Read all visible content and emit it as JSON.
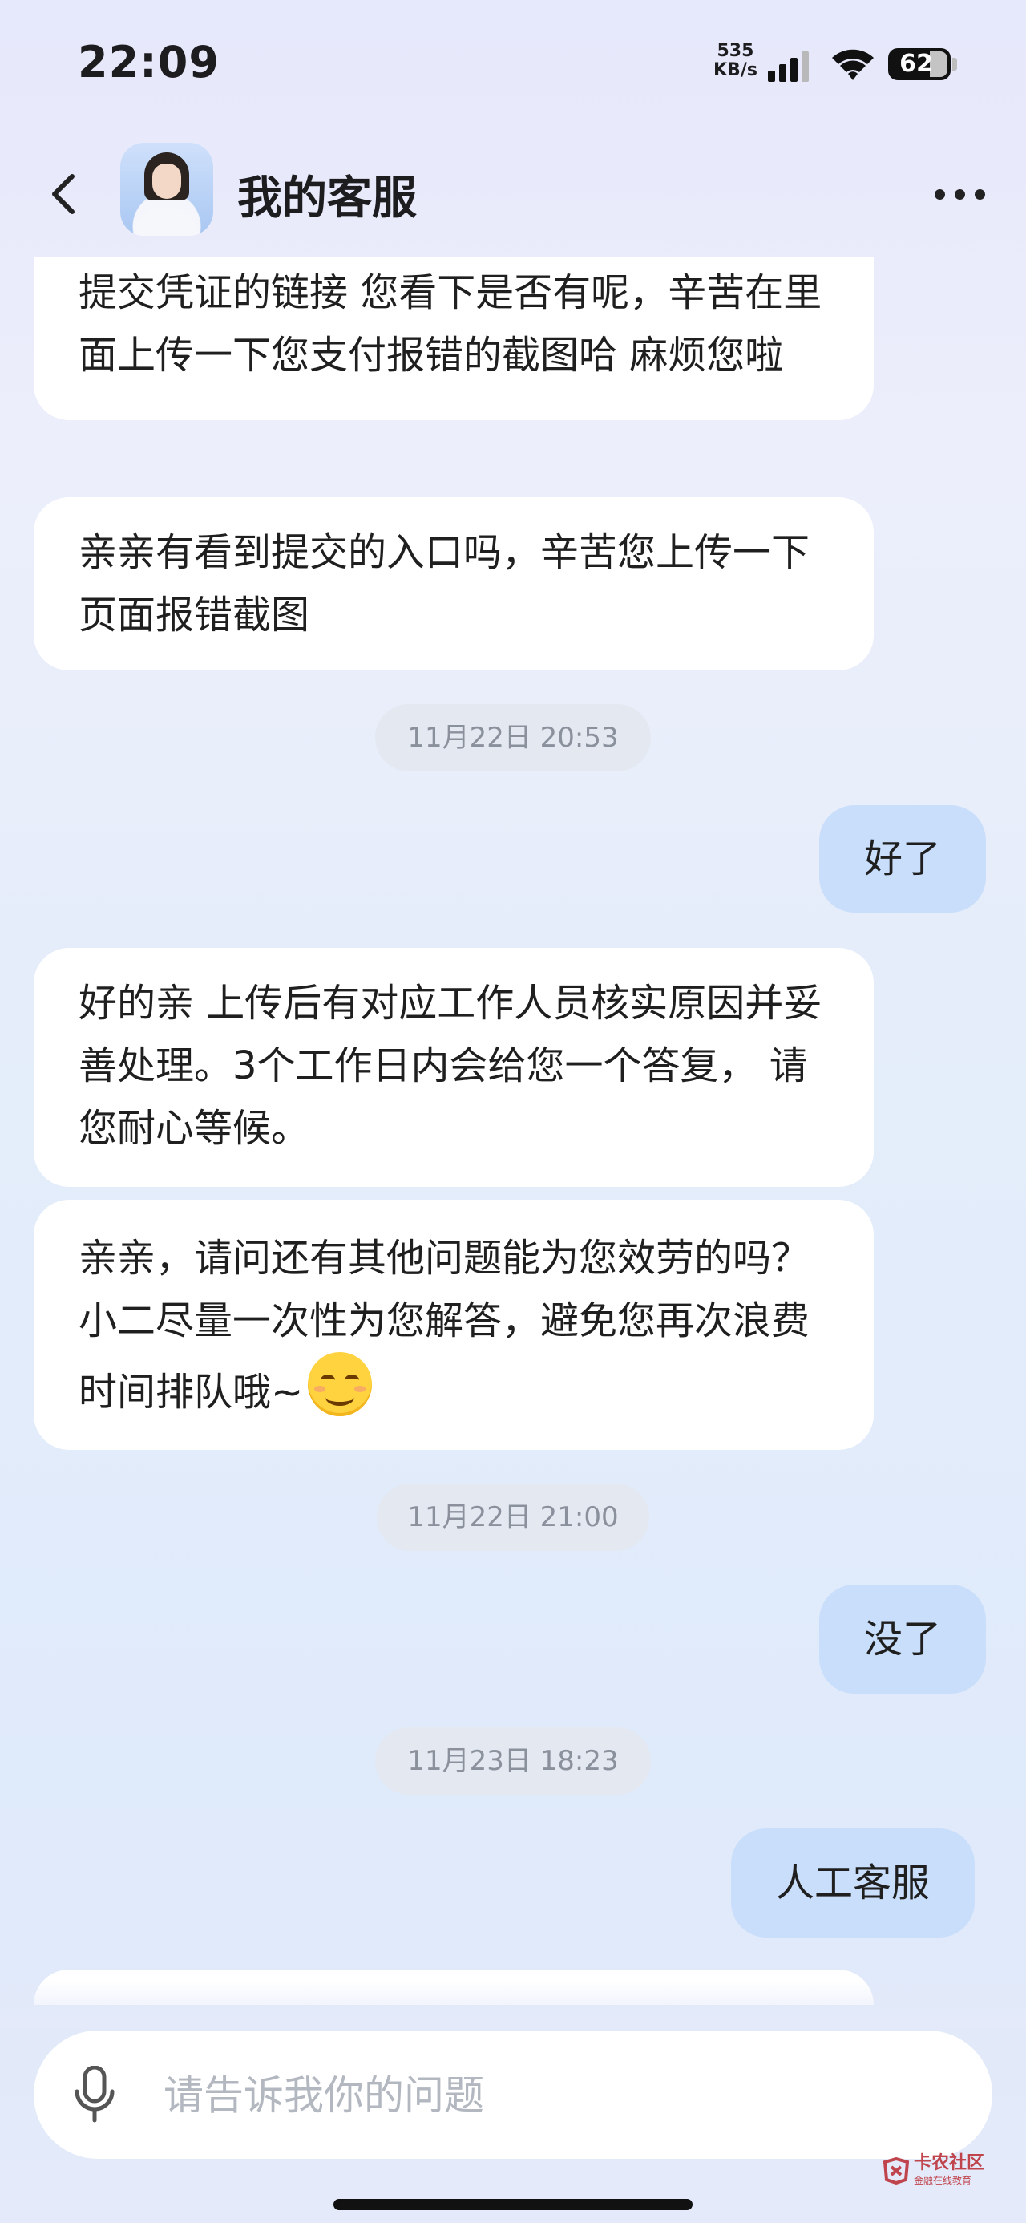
{
  "status_bar": {
    "time": "22:09",
    "net_speed_value": "535",
    "net_speed_unit": "KB/s",
    "battery": "62"
  },
  "header": {
    "title": "我的客服",
    "back_icon": "chevron-left-icon",
    "more_icon": "more-dots-icon"
  },
  "messages": [
    {
      "side": "left",
      "text": "提交凭证的链接 您看下是否有呢，辛苦在里面上传一下您支付报错的截图哈 麻烦您啦"
    },
    {
      "side": "left",
      "text": "亲亲有看到提交的入口吗，辛苦您上传一下页面报错截图"
    },
    {
      "type": "time",
      "text": "11月22日 20:53"
    },
    {
      "side": "right",
      "text": "好了"
    },
    {
      "side": "left",
      "text": "好的亲 上传后有对应工作人员核实原因并妥善处理。3个工作日内会给您一个答复， 请您耐心等候。"
    },
    {
      "side": "left",
      "text": "亲亲，请问还有其他问题能为您效劳的吗？小二尽量一次性为您解答，避免您再次浪费时间排队哦~",
      "emoji": "smiling-face-emoji"
    },
    {
      "type": "time",
      "text": "11月22日 21:00"
    },
    {
      "side": "right",
      "text": "没了"
    },
    {
      "type": "time",
      "text": "11月23日 18:23"
    },
    {
      "side": "right",
      "text": "人工客服"
    }
  ],
  "input": {
    "placeholder": "请告诉我你的问题",
    "value": "",
    "mic_icon": "microphone-icon"
  },
  "watermark": {
    "text": "卡农社区",
    "sub": "金融在线教育"
  }
}
